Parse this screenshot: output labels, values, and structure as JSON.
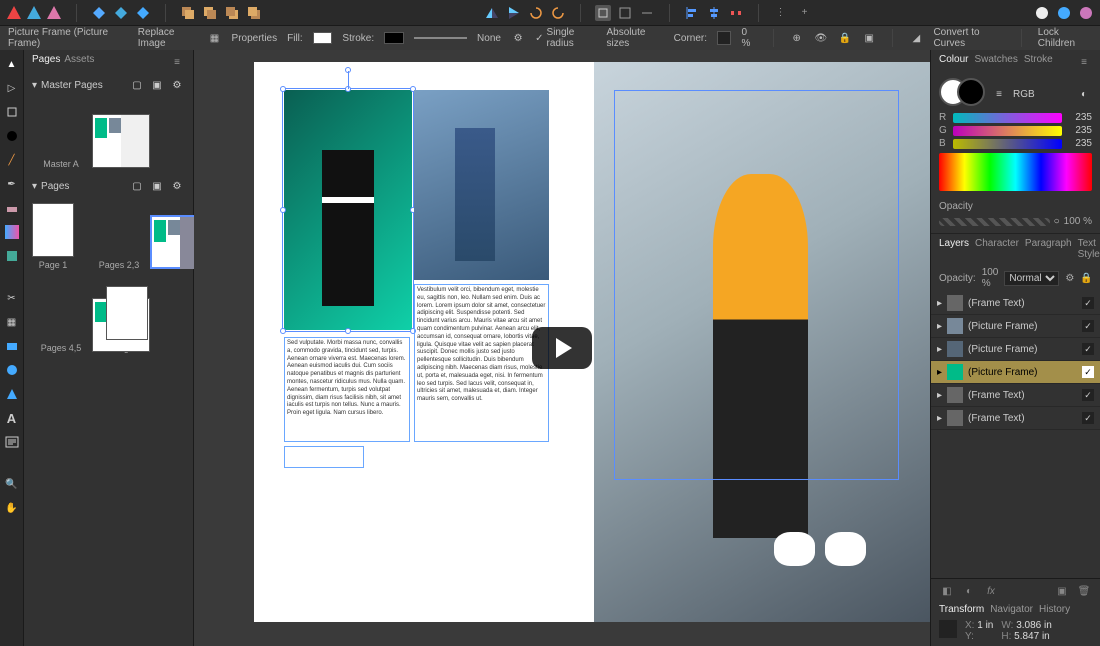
{
  "topbar": {
    "app_icons": [
      "publisher-icon",
      "designer-icon",
      "photo-icon"
    ]
  },
  "contextbar": {
    "object": "Picture Frame (Picture Frame)",
    "replace": "Replace Image",
    "properties": "Properties",
    "fill": "Fill:",
    "stroke": "Stroke:",
    "stroke_val": "None",
    "single_radius": "Single radius",
    "absolute_sizes": "Absolute sizes",
    "corner": "Corner:",
    "corner_pct": "0 %",
    "convert": "Convert to Curves",
    "lock": "Lock Children"
  },
  "pages_panel": {
    "tabs": [
      "Pages",
      "Assets"
    ],
    "master_hdr": "Master Pages",
    "master_a": "Master A",
    "pages_hdr": "Pages",
    "pages": [
      "Page 1",
      "Pages 2,3",
      "Pages 4,5",
      "Page 6"
    ]
  },
  "doc_text": {
    "col1": "Sed vulputate. Morbi massa nunc, convallis a, commodo gravida, tincidunt sed, turpis. Aenean ornare viverra est. Maecenas lorem. Aenean euismod iaculis dui. Cum sociis natoque penatibus et magnis dis parturient montes, nascetur ridiculus mus. Nulla quam. Aenean fermentum, turpis sed volutpat dignissim, diam risus facilisis nibh, sit amet iaculis est turpis non tellus. Nunc a mauris. Proin eget ligula. Nam cursus libero.",
    "col2": "Vestibulum velit orci, bibendum eget, molestie eu, sagittis non, leo. Nullam sed enim. Duis ac lorem. Lorem ipsum dolor sit amet, consectetuer adipiscing elit. Suspendisse potenti. Sed tincidunt varius arcu. Mauris vitae arcu sit amet quam condimentum pulvinar. Aenean arcu elit, accumsan id, consequat ornare, lobortis vitae, ligula. Quisque vitae velit ac sapien placerat suscipit. Donec mollis justo sed justo pellentesque sollicitudin. Duis bibendum adipiscing nibh. Maecenas diam risus, molestie ut, porta et, malesuada eget, nisi. In fermentum leo sed turpis. Sed lacus velit, consequat in, ultricies sit amet, malesuada et, diam. Integer mauris sem, convallis ut."
  },
  "colour_panel": {
    "tabs": [
      "Colour",
      "Swatches",
      "Stroke"
    ],
    "mode": "RGB",
    "r": 235,
    "g": 235,
    "b": 235,
    "opacity_label": "Opacity",
    "opacity": "100 %"
  },
  "layers_panel": {
    "tabs": [
      "Layers",
      "Character",
      "Paragraph",
      "Text Styles"
    ],
    "opacity_lbl": "Opacity:",
    "opacity": "100 %",
    "blend": "Normal",
    "items": [
      {
        "name": "(Frame Text)"
      },
      {
        "name": "(Picture Frame)"
      },
      {
        "name": "(Picture Frame)"
      },
      {
        "name": "(Picture Frame)",
        "selected": true
      },
      {
        "name": "(Frame Text)"
      },
      {
        "name": "(Frame Text)"
      }
    ]
  },
  "transform": {
    "tabs": [
      "Transform",
      "Navigator",
      "History"
    ],
    "x_lbl": "X:",
    "x": "1 in",
    "y_lbl": "Y:",
    "w_lbl": "W:",
    "w": "3.086 in",
    "h_lbl": "H:",
    "h": "5.847 in"
  }
}
